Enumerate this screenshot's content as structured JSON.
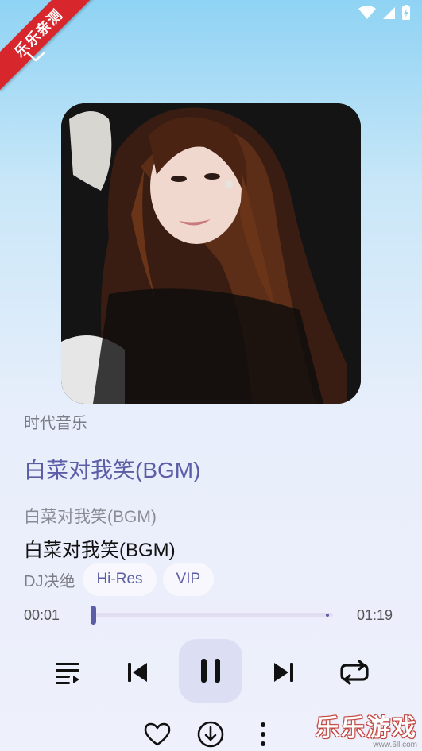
{
  "banner": {
    "text": "乐乐亲测"
  },
  "player": {
    "source": "时代音乐",
    "lyric_current": "白菜对我笑(BGM)",
    "lyric_next": "白菜对我笑(BGM)",
    "title": "白菜对我笑(BGM)",
    "artist": "DJ决绝",
    "badges": [
      "Hi-Res",
      "VIP"
    ],
    "time_elapsed": "00:01",
    "time_total": "01:19",
    "progress": 0.01
  },
  "icons": {
    "collapse": "chevron-down-icon",
    "playlist": "playlist-icon",
    "prev": "skip-previous-icon",
    "pause": "pause-icon",
    "next": "skip-next-icon",
    "repeat": "repeat-icon",
    "like": "heart-icon",
    "download": "download-icon",
    "more": "more-vertical-icon"
  },
  "watermark": {
    "text": "乐乐游戏",
    "url": "www.6ll.com"
  },
  "colors": {
    "accent": "#5b5ea6",
    "banner": "#d8262d"
  }
}
